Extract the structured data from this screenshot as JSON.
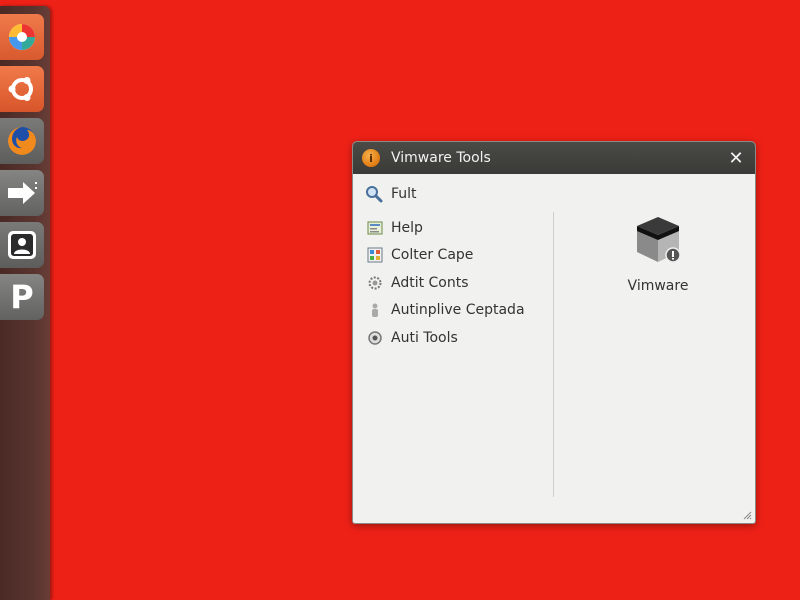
{
  "window": {
    "title": "Vimware Tools",
    "close_glyph": "✕",
    "title_icon_glyph": "i"
  },
  "search": {
    "label": "Fult",
    "icon": "search-icon"
  },
  "menu": {
    "items": [
      {
        "label": "Help",
        "icon": "help-icon"
      },
      {
        "label": "Colter Cape",
        "icon": "display-icon"
      },
      {
        "label": "Adtit Conts",
        "icon": "gear-icon"
      },
      {
        "label": "Autinplive Ceptada",
        "icon": "person-icon"
      },
      {
        "label": "Auti Tools",
        "icon": "tools-icon"
      }
    ]
  },
  "app_tile": {
    "label": "Vimware",
    "icon": "vmware-box-icon"
  },
  "launcher": {
    "items": [
      {
        "icon": "photo-app-icon"
      },
      {
        "icon": "ubuntu-icon"
      },
      {
        "icon": "firefox-icon"
      },
      {
        "icon": "arrow-right-icon"
      },
      {
        "icon": "user-contacts-icon"
      },
      {
        "icon": "p-letter-icon",
        "glyph": "P"
      }
    ]
  },
  "colors": {
    "desktop": "#ee2117",
    "titlebar": "#3f3f3c",
    "window_bg": "#f1f1ef",
    "launcher_accent": "#e8683a"
  }
}
